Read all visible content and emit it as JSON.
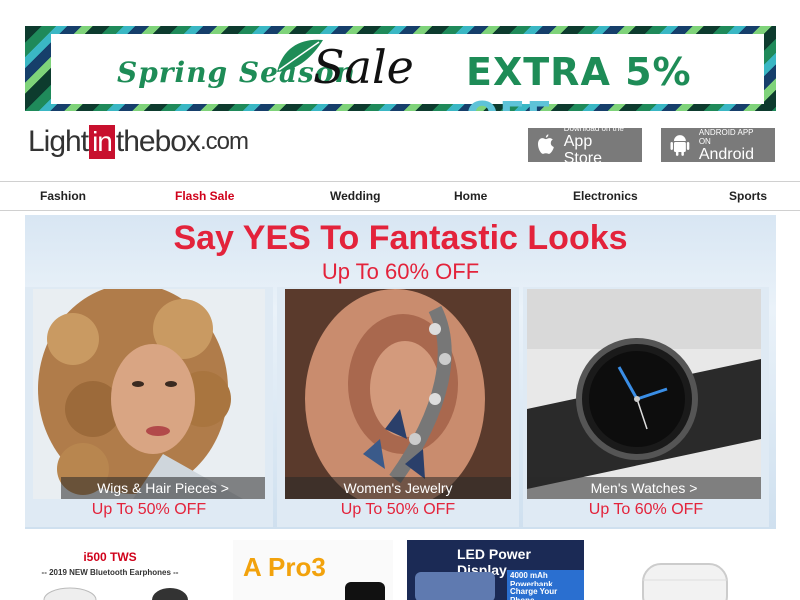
{
  "promo": {
    "spring": "Spring Season",
    "sale": "Sale",
    "extra": "EXTRA 5%",
    "off": "OFF"
  },
  "logo": {
    "part1": "Light",
    "part2": "in",
    "part3": "thebox",
    "part4": ".com"
  },
  "stores": {
    "app_small": "Download on the",
    "app_big": "App Store",
    "android_small": "ANDROID APP ON",
    "android_big": "Android"
  },
  "nav": {
    "items": [
      "Fashion",
      "Flash Sale",
      "Wedding",
      "Home",
      "Electronics",
      "Sports"
    ]
  },
  "hero": {
    "title": "Say YES To Fantastic Looks",
    "subtitle": "Up To 60% OFF",
    "cards": [
      {
        "label": "Wigs & Hair Pieces >",
        "price": "Up To 50% OFF"
      },
      {
        "label": "Women's Jewelry",
        "price": "Up To 50% OFF"
      },
      {
        "label": "Men's Watches >",
        "price": "Up To 60% OFF"
      }
    ]
  },
  "strip": {
    "item1_title": "i500 TWS",
    "item1_sub": "-- 2019 NEW Bluetooth Earphones --",
    "item2_title": "A Pro3",
    "item3_title": "LED Power Display",
    "item3_sub1": "4000 mAh Powerbank",
    "item3_sub2": "Charge Your Phone"
  },
  "colors": {
    "accent_red": "#e3233b",
    "brand_red": "#c8102e",
    "promo_green": "#1e8c57"
  }
}
